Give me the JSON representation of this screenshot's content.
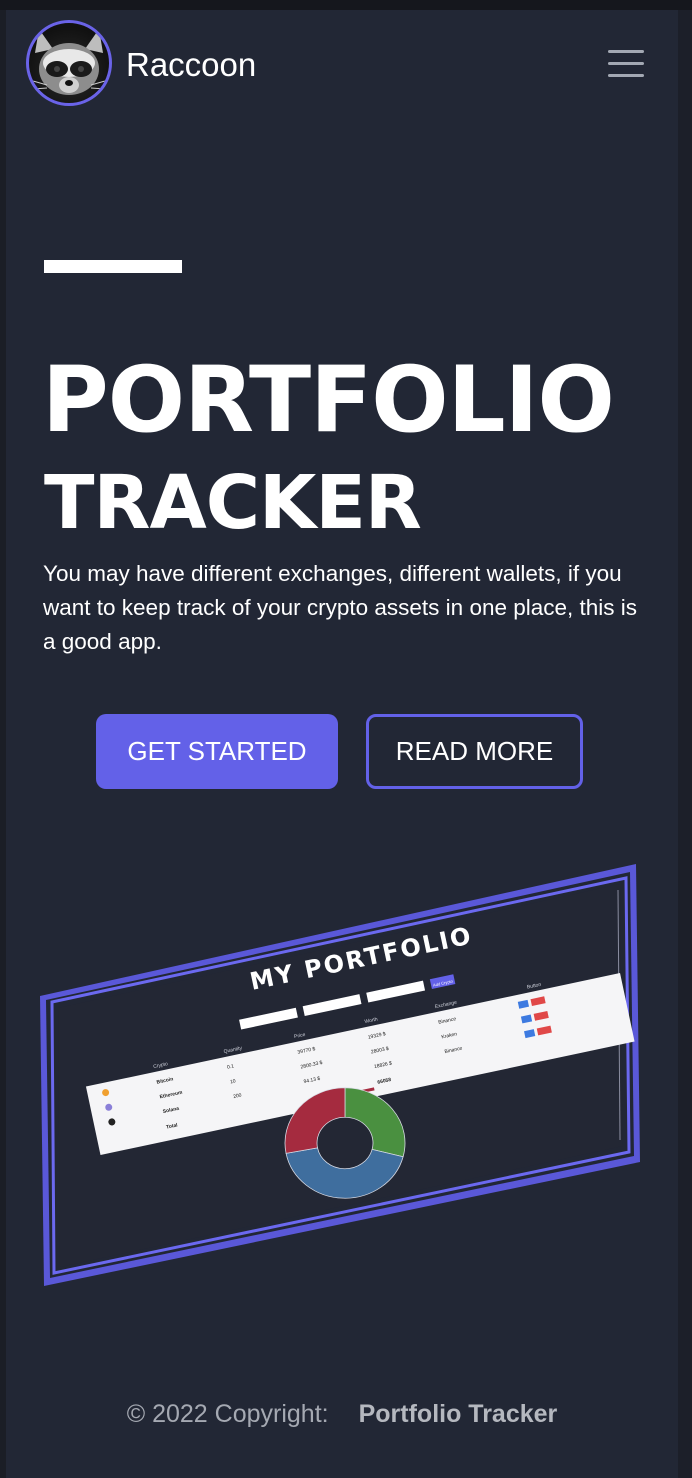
{
  "header": {
    "brand": "Raccoon",
    "menu_icon": "hamburger-menu-icon"
  },
  "hero": {
    "title_line1": "PORTFOLIO",
    "title_line2": "TRACKER",
    "description": "You may have different exchanges, different wallets, if you want to keep track of your crypto assets in one place, this is a good app.",
    "primary_button": "GET STARTED",
    "secondary_button": "READ MORE"
  },
  "preview": {
    "title": "MY PORTFOLIO",
    "column_headers": [
      "Crypto",
      "Quantity",
      "Price",
      "Worth",
      "Exchange",
      "Button"
    ],
    "rows": [
      {
        "crypto": "Bitcoin",
        "quantity": "0.1",
        "price": "39770 $",
        "worth": "19329 $",
        "exchange": "Binance"
      },
      {
        "crypto": "Ethereum",
        "quantity": "10",
        "price": "2800.33 $",
        "worth": "28003 $",
        "exchange": "Kraken"
      },
      {
        "crypto": "Solana",
        "quantity": "200",
        "price": "94.13 $",
        "worth": "18826 $",
        "exchange": "Binance"
      }
    ],
    "total_label": "Total",
    "total_value": "66058",
    "add_label": "Add Crypto",
    "edit_label": "Edit",
    "delete_label": "Delete",
    "donut": [
      {
        "label": "Bitcoin",
        "share": 0.29,
        "color": "#4a9040"
      },
      {
        "label": "Ethereum",
        "share": 0.43,
        "color": "#3f6e9e"
      },
      {
        "label": "Solana",
        "share": 0.28,
        "color": "#a52b3f"
      }
    ],
    "accent_color": "#6361e8"
  },
  "footer": {
    "copyright": "© 2022 Copyright:",
    "app_name": "Portfolio Tracker"
  }
}
